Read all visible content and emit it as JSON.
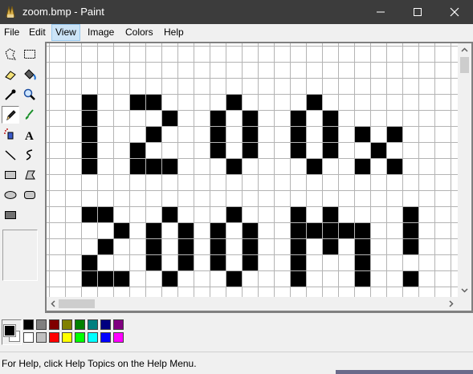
{
  "window": {
    "title": "zoom.bmp - Paint",
    "controls": [
      "minimize-icon",
      "maximize-icon",
      "close-icon"
    ]
  },
  "menu": {
    "items": [
      {
        "label": "File"
      },
      {
        "label": "Edit"
      },
      {
        "label": "View",
        "active": true
      },
      {
        "label": "Image"
      },
      {
        "label": "Colors"
      },
      {
        "label": "Help"
      }
    ]
  },
  "tools": [
    {
      "name": "free-form-select-icon"
    },
    {
      "name": "rect-select-icon"
    },
    {
      "name": "eraser-icon"
    },
    {
      "name": "fill-icon"
    },
    {
      "name": "pick-color-icon"
    },
    {
      "name": "magnifier-icon"
    },
    {
      "name": "pencil-icon",
      "active": true
    },
    {
      "name": "brush-icon"
    },
    {
      "name": "airbrush-icon"
    },
    {
      "name": "text-icon",
      "glyph": "A"
    },
    {
      "name": "line-icon"
    },
    {
      "name": "curve-icon"
    },
    {
      "name": "rectangle-icon"
    },
    {
      "name": "polygon-icon"
    },
    {
      "name": "ellipse-icon"
    },
    {
      "name": "rounded-rect-icon"
    },
    {
      "name": "filled-rect-icon"
    }
  ],
  "canvas": {
    "zoom_text": "1200x ZOOM!",
    "pixels": [
      "0000000000000000000000000",
      "0000000000000000000000000",
      "0000000000000000000000000",
      "0010011000010000100000000",
      "0010000100101001010000000",
      "0010001000101001010101000",
      "0010010000101001010010000",
      "0010011100010000100101000",
      "0000000000000000000000000",
      "0000000000000000000000000",
      "0011000100010001010000100",
      "0000101010101001111100100",
      "0001001010101001010100100",
      "0010001010101001000100000",
      "0011100100010001000100100",
      "0000000000000000000000000"
    ]
  },
  "palette": {
    "foreground": "#000000",
    "background": "#ffffff",
    "top_row": [
      "#000000",
      "#808080",
      "#800000",
      "#808000",
      "#008000",
      "#008080",
      "#000080",
      "#800080"
    ],
    "bottom_row": [
      "#ffffff",
      "#c0c0c0",
      "#ff0000",
      "#ffff00",
      "#00ff00",
      "#00ffff",
      "#0000ff",
      "#ff00ff"
    ]
  },
  "status": {
    "text": "For Help, click Help Topics on the Help Menu."
  }
}
